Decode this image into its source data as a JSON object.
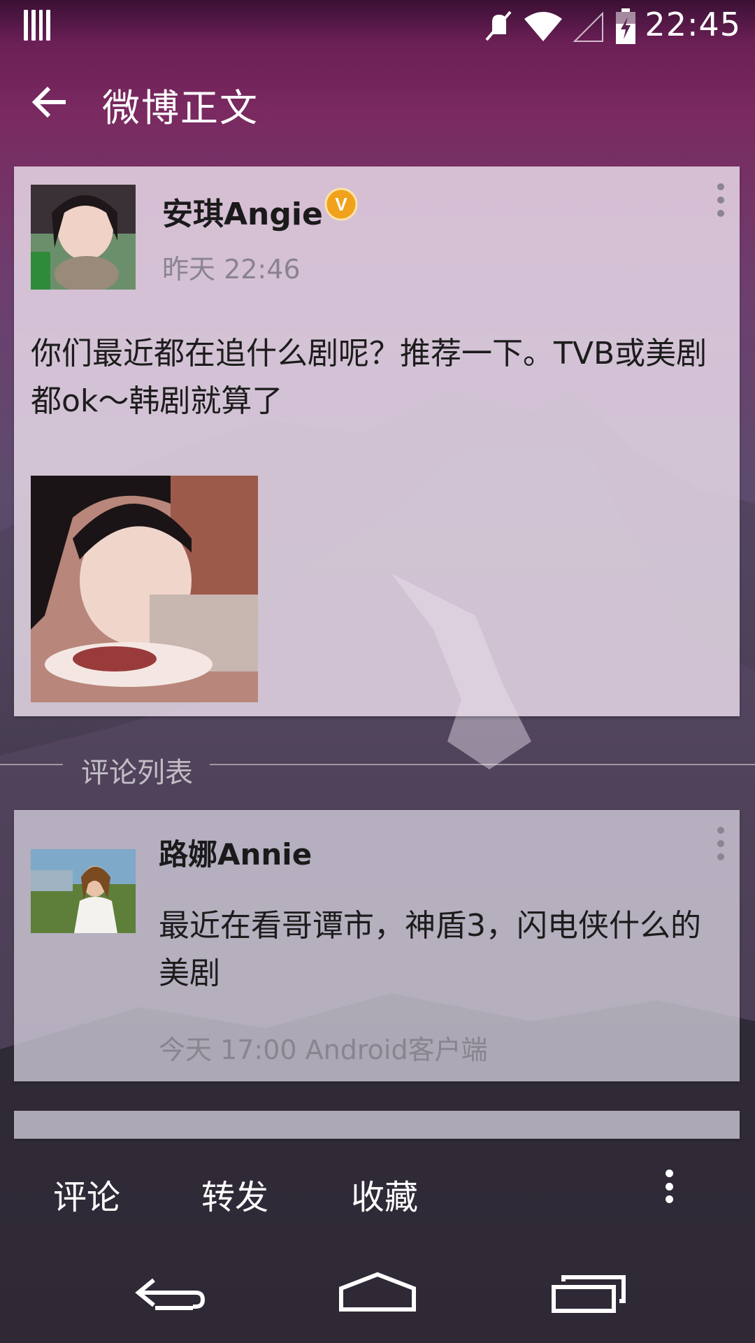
{
  "status_bar": {
    "time": "22:45"
  },
  "app_bar": {
    "title": "微博正文"
  },
  "post": {
    "author": "安琪Angie",
    "verified_badge": "V",
    "time": "昨天 22:46",
    "text": "你们最近都在追什么剧呢？推荐一下。TVB或美剧都ok～韩剧就算了"
  },
  "comments_section": {
    "label": "评论列表"
  },
  "comments": [
    {
      "author": "路娜Annie",
      "text": "最近在看哥谭市，神盾3，闪电侠什么的 美剧",
      "meta": "今天 17:00 Android客户端"
    }
  ],
  "actions": {
    "comment": "评论",
    "forward": "转发",
    "favorite": "收藏"
  },
  "colors": {
    "accent_top": "#6a1f55",
    "card_bg": "#ece0ec",
    "verified": "#f0a21c"
  }
}
